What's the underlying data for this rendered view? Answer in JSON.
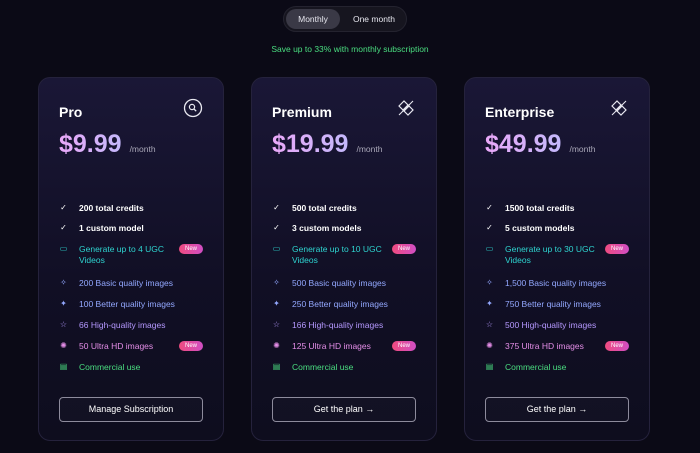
{
  "billing_toggle": {
    "options": [
      "Monthly",
      "One month"
    ],
    "selected": "Monthly"
  },
  "save_note": "Save up to 33% with monthly subscription",
  "badge_label": "New",
  "colors": {
    "accent_green": "#4ade80",
    "price_gradient_start": "#e9a8f8",
    "price_gradient_end": "#c4b8fb",
    "badge": "#ef4b7f"
  },
  "plans": [
    {
      "name": "Pro",
      "icon": "magnifier-circle-icon",
      "price": "$9.99",
      "period": "/month",
      "features": [
        {
          "text": "200 total credits",
          "icon": "check-icon"
        },
        {
          "text": "1 custom model",
          "icon": "check-icon"
        },
        {
          "text": "Generate up to 4 UGC Videos",
          "icon": "video-icon",
          "badge": true
        },
        {
          "text": "200 Basic quality images",
          "icon": "sparkle-icon"
        },
        {
          "text": "100 Better quality images",
          "icon": "sparkles-icon"
        },
        {
          "text": "66 High-quality images",
          "icon": "star-icon"
        },
        {
          "text": "50 Ultra HD images",
          "icon": "sparkle-bright-icon",
          "badge": true
        },
        {
          "text": "Commercial use",
          "icon": "document-icon"
        }
      ],
      "button": "Manage Subscription"
    },
    {
      "name": "Premium",
      "icon": "layers-icon",
      "price": "$19.99",
      "period": "/month",
      "features": [
        {
          "text": "500 total credits",
          "icon": "check-icon"
        },
        {
          "text": "3 custom models",
          "icon": "check-icon"
        },
        {
          "text": "Generate up to 10 UGC Videos",
          "icon": "video-icon",
          "badge": true
        },
        {
          "text": "500 Basic quality images",
          "icon": "sparkle-icon"
        },
        {
          "text": "250 Better quality images",
          "icon": "sparkles-icon"
        },
        {
          "text": "166 High-quality images",
          "icon": "star-icon"
        },
        {
          "text": "125 Ultra HD images",
          "icon": "sparkle-bright-icon",
          "badge": true
        },
        {
          "text": "Commercial use",
          "icon": "document-icon"
        }
      ],
      "button": "Get the plan →"
    },
    {
      "name": "Enterprise",
      "icon": "layers-icon",
      "price": "$49.99",
      "period": "/month",
      "features": [
        {
          "text": "1500 total credits",
          "icon": "check-icon"
        },
        {
          "text": "5 custom models",
          "icon": "check-icon"
        },
        {
          "text": "Generate up to 30 UGC Videos",
          "icon": "video-icon",
          "badge": true
        },
        {
          "text": "1,500 Basic quality images",
          "icon": "sparkle-icon"
        },
        {
          "text": "750 Better quality images",
          "icon": "sparkles-icon"
        },
        {
          "text": "500 High-quality images",
          "icon": "star-icon"
        },
        {
          "text": "375 Ultra HD images",
          "icon": "sparkle-bright-icon",
          "badge": true
        },
        {
          "text": "Commercial use",
          "icon": "document-icon"
        }
      ],
      "button": "Get the plan →"
    }
  ]
}
